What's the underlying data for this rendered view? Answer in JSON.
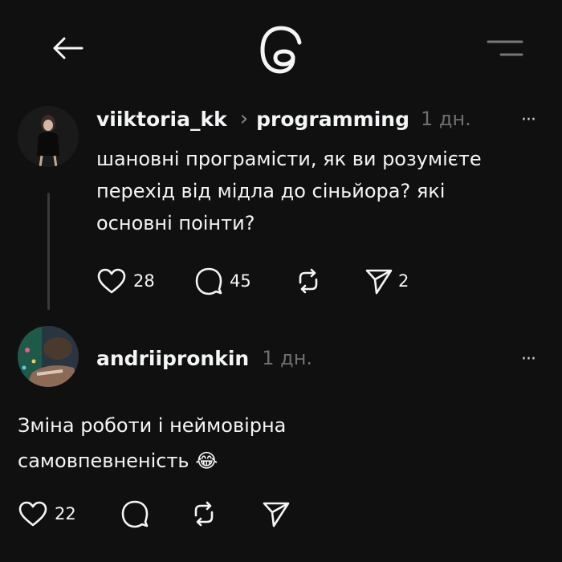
{
  "header": {
    "back_icon": "arrow-left-icon",
    "logo_icon": "threads-logo-icon",
    "menu_icon": "menu-icon"
  },
  "post": {
    "username": "viiktoria_kk",
    "community_separator": "›",
    "community": "programming",
    "time": "1 дн.",
    "more": "···",
    "text_lines": [
      "шановні програмісти, як ви розумієте",
      "перехід від мідла до сіньйора? які",
      "основні поінти?"
    ],
    "likes": "28",
    "comments": "45",
    "shares": "2"
  },
  "reply": {
    "username": "andriipronkin",
    "time": "1 дн.",
    "more": "···",
    "text_lines": [
      "Зміна роботи і неймовірна",
      "самовпевненість 😂"
    ],
    "likes": "22"
  },
  "colors": {
    "background": "#101010",
    "text": "#f3f5f7",
    "muted": "#6f6f6f",
    "thread_line": "#3a3a3a"
  }
}
